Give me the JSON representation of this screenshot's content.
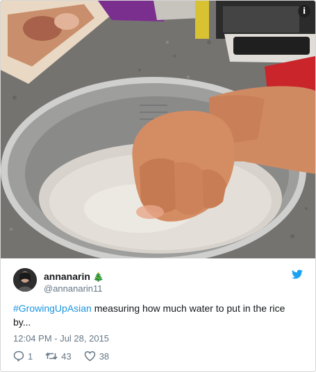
{
  "icons": {
    "info": "info-icon",
    "tree": "christmas-tree-icon",
    "bird": "twitter-bird-icon",
    "reply": "reply-icon",
    "retweet": "retweet-icon",
    "like": "heart-icon"
  },
  "media": {
    "info_glyph": "i"
  },
  "tweet": {
    "display_name": "annanarin",
    "name_emoji": "🎄",
    "handle": "@annanarin11",
    "hashtag": "#GrowingUpAsian",
    "text": " measuring how much water to put in the rice by...",
    "timestamp": "12:04 PM - Jul 28, 2015",
    "reply_count": "1",
    "retweet_count": "43",
    "like_count": "38"
  },
  "colors": {
    "link": "#1b95e0",
    "secondary_text": "#657786",
    "primary_text": "#14171a",
    "twitter_blue": "#1da1f2"
  }
}
